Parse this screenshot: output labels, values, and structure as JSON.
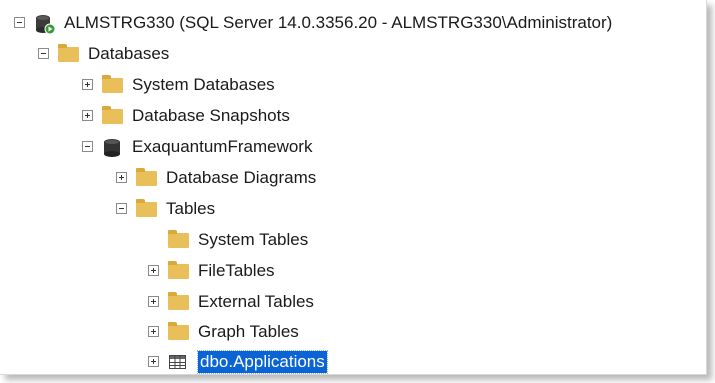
{
  "tree": {
    "server": {
      "label": "ALMSTRG330 (SQL Server 14.0.3356.20 - ALMSTRG330\\Administrator)",
      "icon": "server-running-icon",
      "expanded": true
    },
    "databases": {
      "label": "Databases",
      "icon": "folder-icon",
      "expanded": true
    },
    "system_databases": {
      "label": "System Databases",
      "icon": "folder-icon",
      "expanded": false
    },
    "database_snapshots": {
      "label": "Database Snapshots",
      "icon": "folder-icon",
      "expanded": false
    },
    "exaquantum": {
      "label": "ExaquantumFramework",
      "icon": "database-icon",
      "expanded": true
    },
    "database_diagrams": {
      "label": "Database Diagrams",
      "icon": "folder-icon",
      "expanded": false
    },
    "tables": {
      "label": "Tables",
      "icon": "folder-icon",
      "expanded": true
    },
    "system_tables": {
      "label": "System Tables",
      "icon": "folder-icon"
    },
    "file_tables": {
      "label": "FileTables",
      "icon": "folder-icon",
      "expanded": false
    },
    "external_tables": {
      "label": "External Tables",
      "icon": "folder-icon",
      "expanded": false
    },
    "graph_tables": {
      "label": "Graph Tables",
      "icon": "folder-icon",
      "expanded": false
    },
    "dbo_applications": {
      "label": "dbo.Applications",
      "icon": "table-icon",
      "selected": true,
      "expanded": false
    }
  },
  "colors": {
    "folder": "#e9bf5a",
    "selection": "#0a64d3",
    "server_status": "#3a9a3a"
  }
}
